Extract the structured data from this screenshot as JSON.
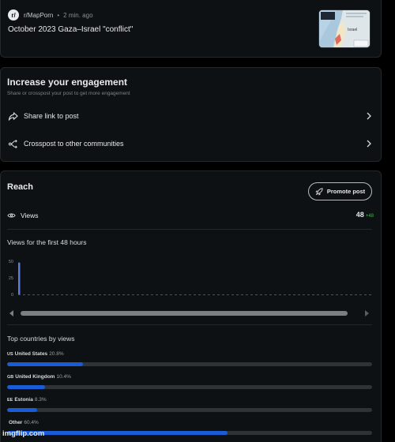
{
  "post": {
    "subreddit": "r/MapPorn",
    "separator": "•",
    "time": "2 min. ago",
    "title": "October 2023 Gaza–Israel \"conflict\"",
    "thumbnail_label": "Israel"
  },
  "engagement": {
    "title": "Increase your engagement",
    "subtitle": "Share or crosspost your post to get more engagement",
    "share_label": "Share link to post",
    "crosspost_label": "Crosspost to other communities"
  },
  "reach": {
    "title": "Reach",
    "promote_label": "Promote post",
    "views_label": "Views",
    "views_count": "48",
    "views_delta": "+48",
    "chart_title": "Views for the first 48 hours",
    "top_countries_title": "Top countries by views",
    "countries": [
      {
        "code": "US",
        "name": "United States",
        "pct_label": "20.8%",
        "pct": 20.8
      },
      {
        "code": "GB",
        "name": "United Kingdom",
        "pct_label": "10.4%",
        "pct": 10.4
      },
      {
        "code": "EE",
        "name": "Estonia",
        "pct_label": "8.3%",
        "pct": 8.3
      },
      {
        "code": "",
        "name": "Other",
        "pct_label": "60.4%",
        "pct": 60.4
      }
    ]
  },
  "chart_data": {
    "type": "bar",
    "title": "Views for the first 48 hours",
    "y_ticks": [
      "50",
      "25",
      "0"
    ],
    "ylim": [
      0,
      50
    ],
    "x_hours": 48,
    "values": [
      48,
      0,
      0,
      0,
      0,
      0,
      0,
      0,
      0,
      0,
      0,
      0,
      0,
      0,
      0,
      0,
      0,
      0,
      0,
      0,
      0,
      0,
      0,
      0,
      0,
      0,
      0,
      0,
      0,
      0,
      0,
      0,
      0,
      0,
      0,
      0,
      0,
      0,
      0,
      0,
      0,
      0,
      0,
      0,
      0,
      0,
      0,
      0
    ],
    "bar_color": "#5b7bd6",
    "grid": false
  },
  "colors": {
    "accent_bar": "#1a5bd6",
    "delta_green": "#3fb950",
    "card_bg": "#0e1113"
  },
  "watermark": "imgflip.com"
}
